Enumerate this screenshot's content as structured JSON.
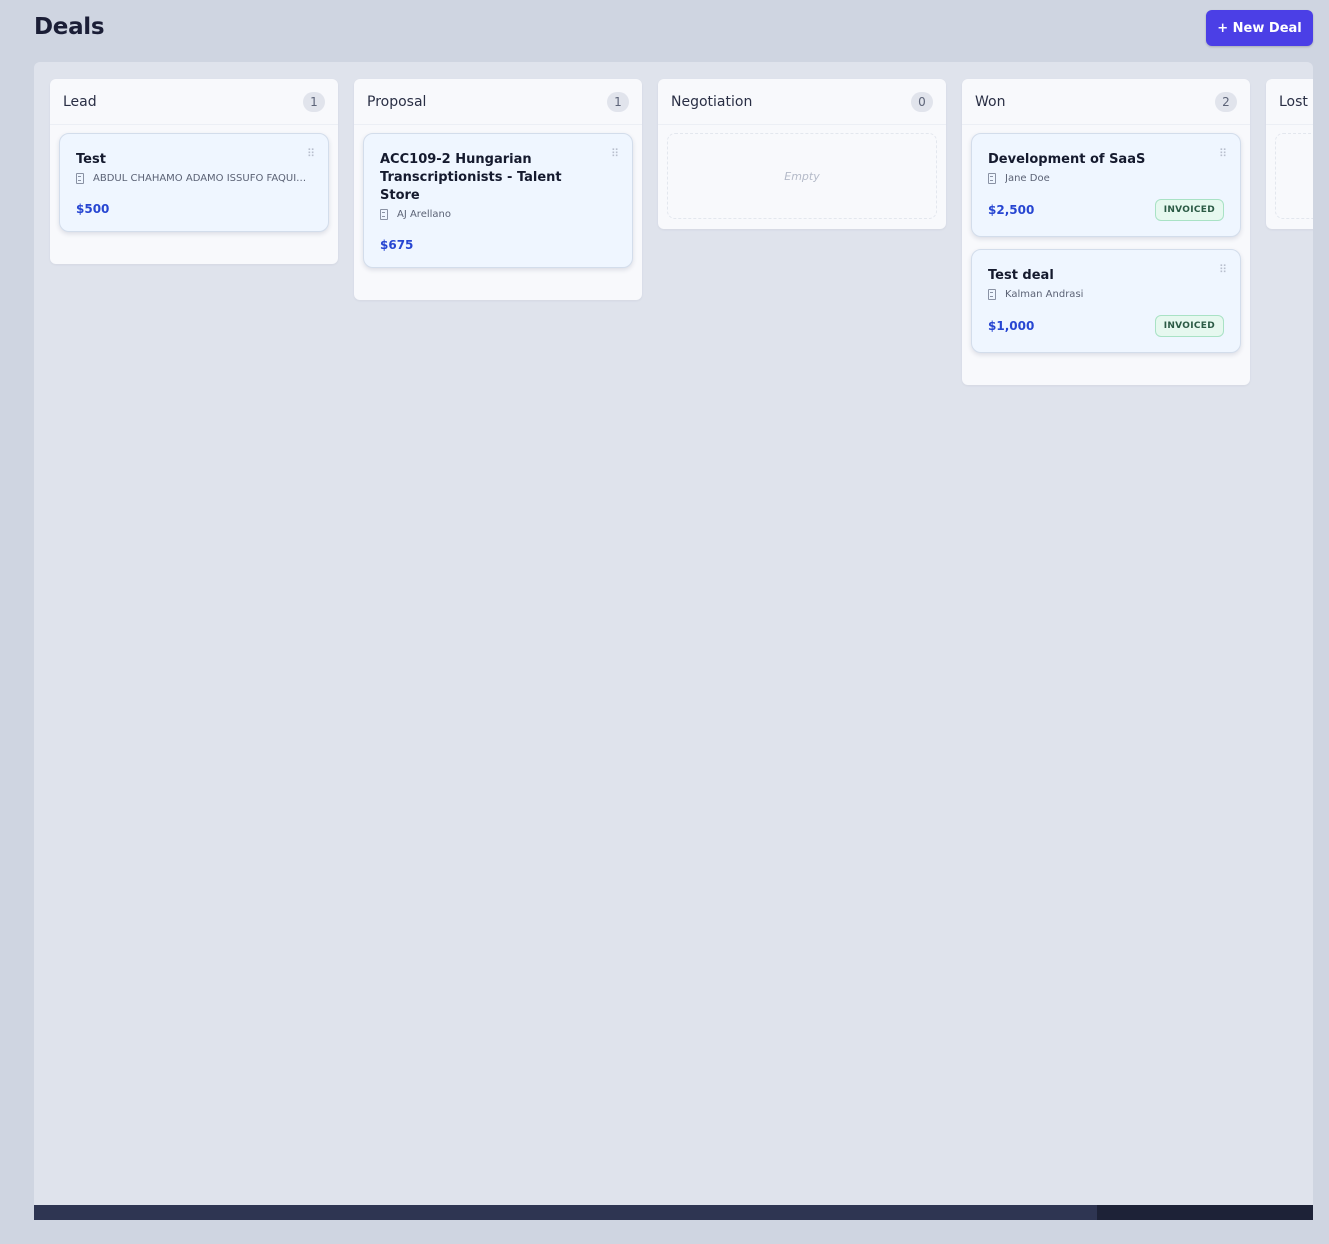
{
  "header": {
    "title": "Deals",
    "new_deal_label": "+ New Deal"
  },
  "columns": [
    {
      "title": "Lead",
      "count": "1",
      "cards": [
        {
          "title": "Test",
          "company": "ABDUL CHAHAMO ADAMO ISSUFO FAQUIR IB...",
          "value": "$500",
          "badge": ""
        }
      ]
    },
    {
      "title": "Proposal",
      "count": "1",
      "cards": [
        {
          "title": "ACC109-2 Hungarian Transcriptionists - Talent Store",
          "company": "AJ Arellano",
          "value": "$675",
          "badge": ""
        }
      ]
    },
    {
      "title": "Negotiation",
      "count": "0",
      "empty_label": "Empty",
      "cards": []
    },
    {
      "title": "Won",
      "count": "2",
      "cards": [
        {
          "title": "Development of SaaS",
          "company": "Jane Doe",
          "value": "$2,500",
          "badge": "INVOICED"
        },
        {
          "title": "Test deal",
          "company": "Kalman Andrasi",
          "value": "$1,000",
          "badge": "INVOICED"
        }
      ]
    },
    {
      "title": "Lost",
      "count": "",
      "cards": []
    }
  ],
  "scroll": {
    "position_fraction": 0.83
  }
}
